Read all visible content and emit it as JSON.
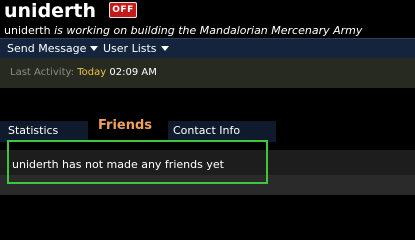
{
  "profile": {
    "username": "uniderth",
    "status_badge": "OFF",
    "status_user": "uniderth",
    "status_mood": "is working on building the Mandalorian Mercenary Army"
  },
  "actions": {
    "send_message": "Send Message",
    "user_lists": "User Lists"
  },
  "activity": {
    "label": "Last Activity:",
    "day": "Today",
    "time": "02:09 AM"
  },
  "tabs": {
    "statistics": "Statistics",
    "friends": "Friends",
    "contact_info": "Contact Info"
  },
  "friends": {
    "empty_message": "uniderth has not made any friends yet"
  },
  "colors": {
    "highlight_box": "#3fc63f",
    "active_tab": "#f0a060",
    "today": "#f0c040",
    "off_badge": "#c41a1a"
  }
}
